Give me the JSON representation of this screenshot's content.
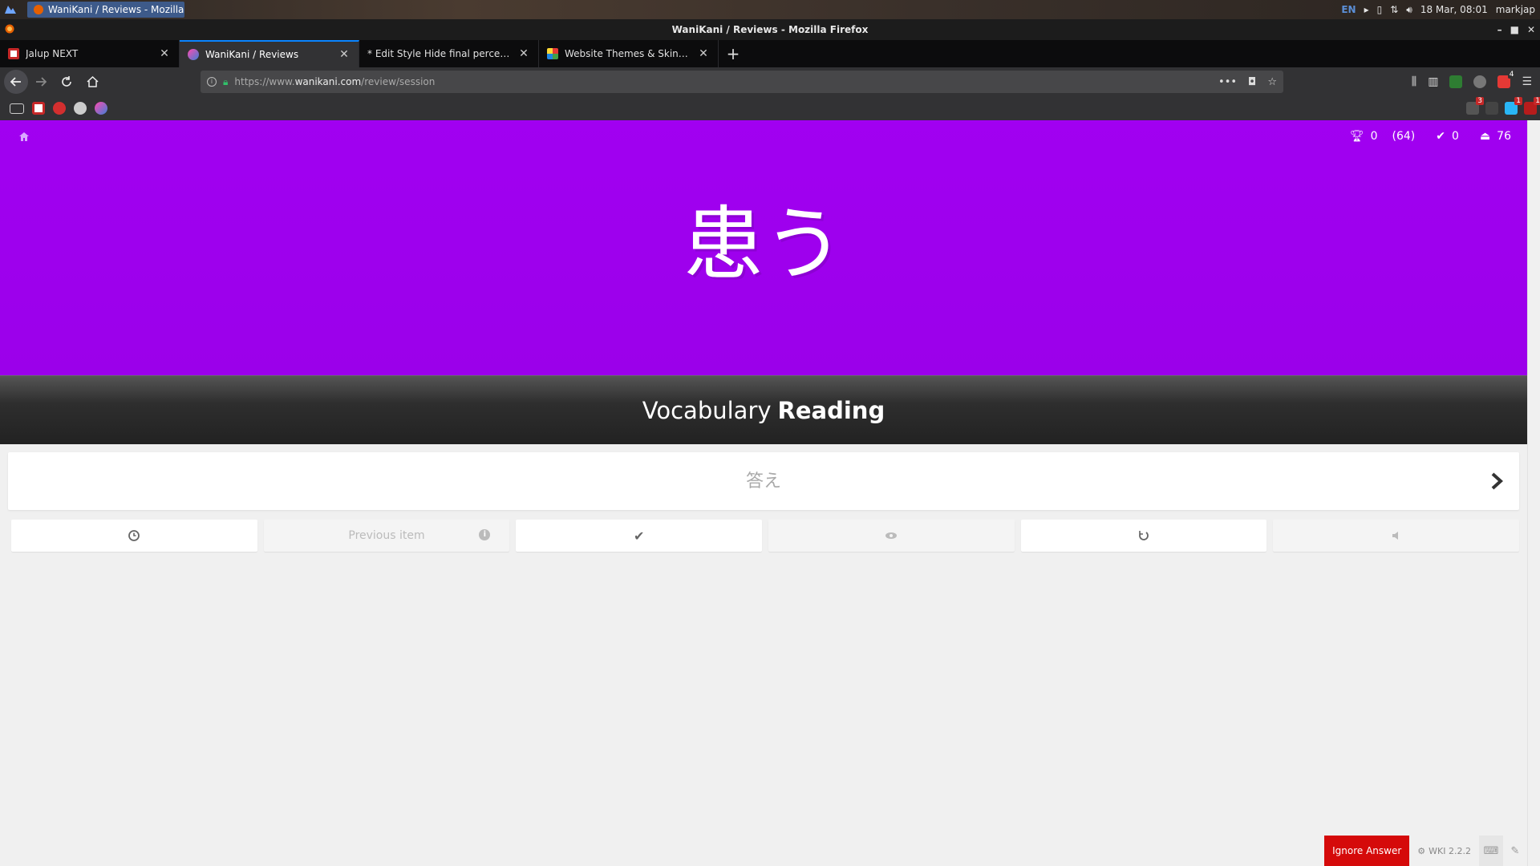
{
  "os_panel": {
    "task_title": "WaniKani / Reviews - Mozilla ...",
    "lang": "EN",
    "datetime": "18 Mar, 08:01",
    "user": "markjap"
  },
  "window": {
    "title": "WaniKani / Reviews - Mozilla Firefox"
  },
  "tabs": [
    {
      "label": "Jalup NEXT",
      "favicon_color": "#c62828",
      "active": false
    },
    {
      "label": "WaniKani / Reviews",
      "favicon_color": "#3d7fd6",
      "active": true
    },
    {
      "label": "* Edit Style Hide final percentage",
      "favicon_color": "",
      "active": false
    },
    {
      "label": "Website Themes & Skins by S",
      "favicon_color": "#4caf50",
      "active": false
    }
  ],
  "navbar": {
    "url_prefix": "https://www.",
    "url_domain": "wanikani.com",
    "url_path": "/review/session",
    "ext_badge_1": "4"
  },
  "bookmarks": {
    "badge_1": "3",
    "badge_2": "1",
    "badge_3": "1"
  },
  "review": {
    "stats": {
      "correct_rate": "0",
      "correct_total": "(64)",
      "completed": "0",
      "remaining": "76"
    },
    "character": "患う",
    "question_type_category": "Vocabulary",
    "question_type_kind": "Reading",
    "answer_placeholder": "答え",
    "additional": {
      "previous_item_label": "Previous item"
    },
    "colors": {
      "vocabulary": "#a100f1",
      "ignore": "#d50a0a"
    }
  },
  "footer": {
    "ignore_answer_label": "Ignore Answer",
    "wki_version": "WKI 2.2.2"
  }
}
